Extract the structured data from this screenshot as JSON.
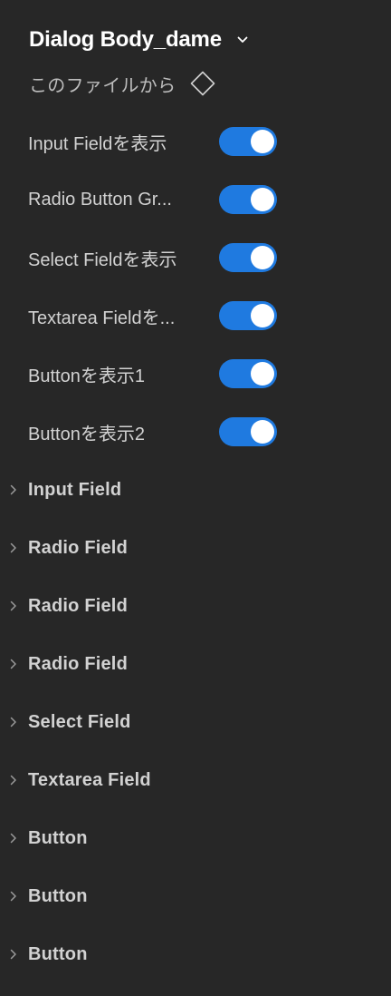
{
  "header": {
    "title": "Dialog Body_dame",
    "chevron_icon": "chevron-down-icon"
  },
  "source": {
    "label": "このファイルから",
    "icon": "component-diamond-icon"
  },
  "properties": [
    {
      "label": "Input Fieldを表示",
      "enabled": true
    },
    {
      "label": "Radio Button Gr...",
      "enabled": true
    },
    {
      "label": "Select Fieldを表示",
      "enabled": true
    },
    {
      "label": "Textarea Fieldを...",
      "enabled": true
    },
    {
      "label": "Buttonを表示1",
      "enabled": true
    },
    {
      "label": "Buttonを表示2",
      "enabled": true
    }
  ],
  "layers": [
    {
      "label": "Input Field"
    },
    {
      "label": "Radio Field"
    },
    {
      "label": "Radio Field"
    },
    {
      "label": "Radio Field"
    },
    {
      "label": "Select Field"
    },
    {
      "label": "Textarea Field"
    },
    {
      "label": "Button"
    },
    {
      "label": "Button"
    },
    {
      "label": "Button"
    }
  ],
  "colors": {
    "background": "#272727",
    "toggle_on": "#1f7ae0",
    "text_primary": "#ffffff",
    "text_secondary": "#d2d2d2"
  }
}
